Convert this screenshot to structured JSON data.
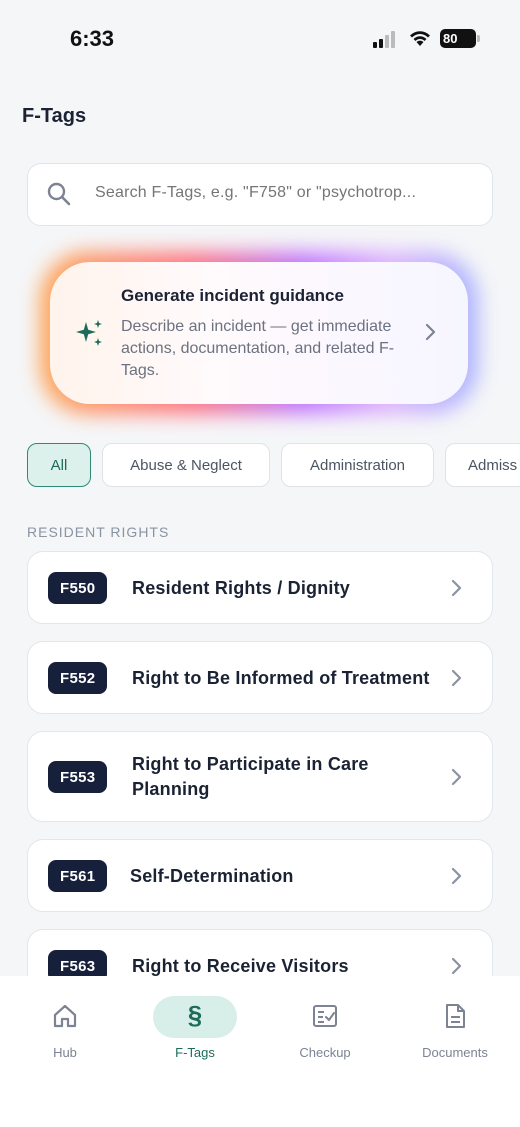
{
  "status_bar": {
    "time": "6:33",
    "battery": "80"
  },
  "page": {
    "title": "F-Tags"
  },
  "search": {
    "placeholder": "Search F-Tags, e.g. \"F758\" or \"psychotrop..."
  },
  "incident": {
    "title": "Generate incident guidance",
    "description": "Describe an incident — get immediate actions, documentation, and related F-Tags."
  },
  "filters": [
    {
      "label": "All",
      "active": true
    },
    {
      "label": "Abuse & Neglect",
      "active": false
    },
    {
      "label": "Administration",
      "active": false
    },
    {
      "label": "Admiss",
      "active": false
    }
  ],
  "section": {
    "label": "RESIDENT RIGHTS"
  },
  "tags": [
    {
      "code": "F550",
      "title": "Resident Rights / Dignity"
    },
    {
      "code": "F552",
      "title": "Right to Be Informed of Treatment"
    },
    {
      "code": "F553",
      "title": "Right to Participate in Care Planning"
    },
    {
      "code": "F561",
      "title": "Self-Determination"
    },
    {
      "code": "F563",
      "title": "Right to Receive Visitors"
    }
  ],
  "nav": [
    {
      "label": "Hub",
      "icon": "home-icon",
      "active": false
    },
    {
      "label": "F-Tags",
      "icon": "section-icon",
      "active": true
    },
    {
      "label": "Checkup",
      "icon": "checklist-icon",
      "active": false
    },
    {
      "label": "Documents",
      "icon": "document-icon",
      "active": false
    }
  ],
  "colors": {
    "accent": "#1d6b59",
    "accent_bg": "#d7efe8",
    "badge": "#17203a"
  }
}
